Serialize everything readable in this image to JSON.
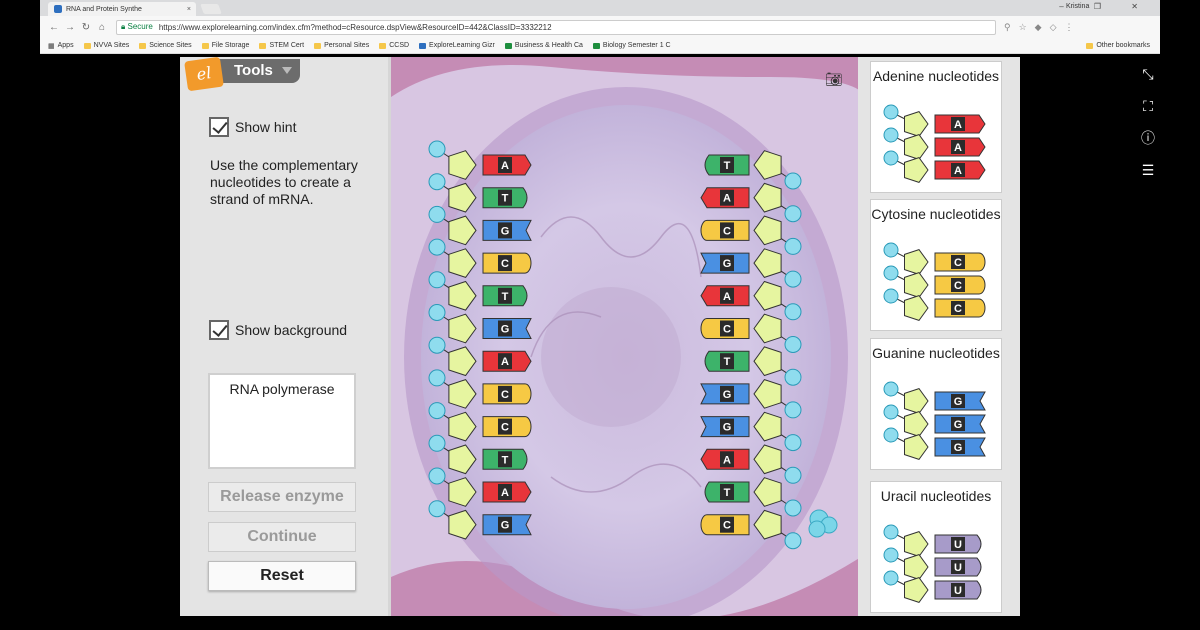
{
  "browser": {
    "tab_title": "RNA and Protein Synthe",
    "tab_close": "×",
    "user_name": "Kristina",
    "window_controls": "–  ❐  ✕",
    "secure_label": "Secure",
    "url": "https://www.explorelearning.com/index.cfm?method=cResource.dspView&ResourceID=442&ClassID=3332212",
    "bookmarks": [
      "Apps",
      "NVVA Sites",
      "Science Sites",
      "File Storage",
      "STEM Cert",
      "Personal Sites",
      "CCSD",
      "ExploreLearning Gizr",
      "Business & Health Ca",
      "Biology Semester 1 C"
    ],
    "other_bookmarks": "Other bookmarks"
  },
  "tools": {
    "label": "Tools",
    "logo": "el"
  },
  "controls": {
    "show_hint": "Show hint",
    "instructions": "Use the complementary nucleotides to create a strand of mRNA.",
    "show_background": "Show background",
    "enzyme_box": "RNA polymerase",
    "release_enzyme": "Release enzyme",
    "continue": "Continue",
    "reset": "Reset"
  },
  "dna": {
    "left_strand": [
      "A",
      "T",
      "G",
      "C",
      "T",
      "G",
      "A",
      "C",
      "C",
      "T",
      "A",
      "G"
    ],
    "right_strand": [
      "T",
      "A",
      "C",
      "G",
      "A",
      "C",
      "T",
      "G",
      "G",
      "A",
      "T",
      "C"
    ]
  },
  "base_colors": {
    "A": "#e8353a",
    "T": "#3db36a",
    "G": "#4a90e2",
    "C": "#f6c944",
    "U": "#a79bc9"
  },
  "panels": [
    {
      "title": "Adenine nucleotides",
      "base": "A"
    },
    {
      "title": "Cytosine nucleotides",
      "base": "C"
    },
    {
      "title": "Guanine nucleotides",
      "base": "G"
    },
    {
      "title": "Uracil nucleotides",
      "base": "U"
    }
  ]
}
